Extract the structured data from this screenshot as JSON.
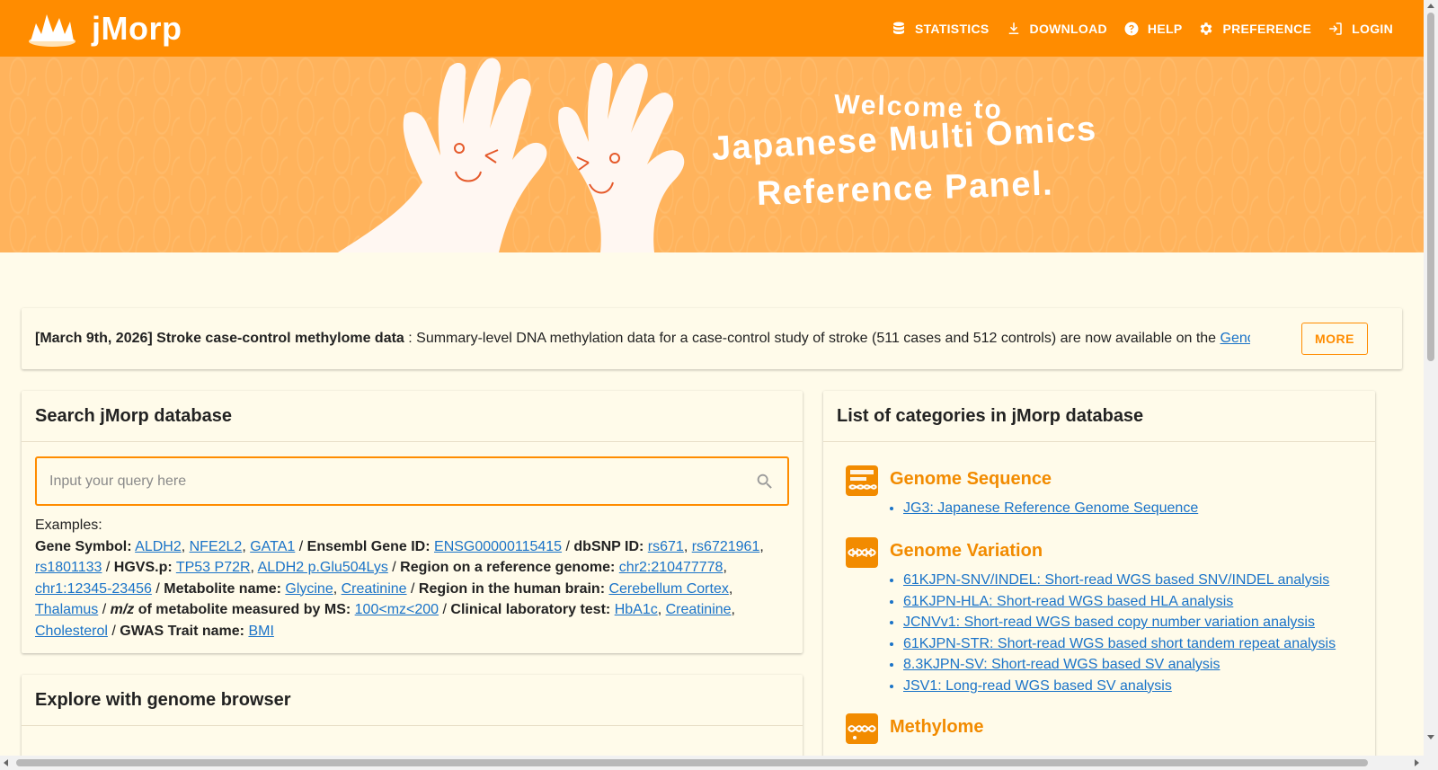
{
  "header": {
    "title": "jMorp",
    "nav": [
      {
        "label": "STATISTICS",
        "icon": "database-icon"
      },
      {
        "label": "DOWNLOAD",
        "icon": "download-icon"
      },
      {
        "label": "HELP",
        "icon": "help-icon"
      },
      {
        "label": "PREFERENCE",
        "icon": "gear-icon"
      },
      {
        "label": "LOGIN",
        "icon": "login-icon"
      }
    ]
  },
  "hero": {
    "line1": "Welcome to",
    "line2": "Japanese Multi Omics",
    "line3": "Reference Panel."
  },
  "news": {
    "date": "[March 9th, 2026]",
    "headline": "Stroke case-control methylome data",
    "body": " : Summary-level DNA methylation data for a case-control study of stroke (511 cases and 512 controls) are now available on the ",
    "link": "Genome",
    "more_label": "MORE"
  },
  "search": {
    "title": "Search jMorp database",
    "placeholder": "Input your query here",
    "examples_label": "Examples:",
    "groups": {
      "gene_symbol": {
        "label": "Gene Symbol:",
        "items": [
          "ALDH2",
          "NFE2L2",
          "GATA1"
        ]
      },
      "ensembl": {
        "label": "Ensembl Gene ID:",
        "items": [
          "ENSG00000115415"
        ]
      },
      "dbsnp": {
        "label": "dbSNP ID:",
        "items": [
          "rs671",
          "rs6721961",
          "rs1801133"
        ]
      },
      "hgvs": {
        "label": "HGVS.p:",
        "items": [
          "TP53 P72R",
          "ALDH2 p.Glu504Lys"
        ]
      },
      "region": {
        "label": "Region on a reference genome:",
        "items": [
          "chr2:210477778",
          "chr1:12345-23456"
        ]
      },
      "metabolite": {
        "label": "Metabolite name:",
        "items": [
          "Glycine",
          "Creatinine"
        ]
      },
      "brain": {
        "label": "Region in the human brain:",
        "items": [
          "Cerebellum Cortex",
          "Thalamus"
        ]
      },
      "mz": {
        "label_italic": "m/z",
        "label_rest": " of metabolite measured by MS:",
        "items": [
          "100<mz<200"
        ]
      },
      "clinical": {
        "label": "Clinical laboratory test:",
        "items": [
          "HbA1c",
          "Creatinine",
          "Cholesterol"
        ]
      },
      "gwas": {
        "label": "GWAS Trait name:",
        "items": [
          "BMI"
        ]
      }
    }
  },
  "explore": {
    "title": "Explore with genome browser"
  },
  "categories": {
    "title": "List of categories in jMorp database",
    "groups": [
      {
        "name": "Genome Sequence",
        "icon": "genome-sequence-icon",
        "items": [
          "JG3: Japanese Reference Genome Sequence"
        ]
      },
      {
        "name": "Genome Variation",
        "icon": "dna-icon",
        "items": [
          "61KJPN-SNV/INDEL: Short-read WGS based SNV/INDEL analysis",
          "61KJPN-HLA: Short-read WGS based HLA analysis",
          "JCNVv1: Short-read WGS based copy number variation analysis",
          "61KJPN-STR: Short-read WGS based short tandem repeat analysis",
          "8.3KJPN-SV: Short-read WGS based SV analysis",
          "JSV1: Long-read WGS based SV analysis"
        ]
      },
      {
        "name": "Methylome",
        "icon": "methylome-icon",
        "items": []
      }
    ]
  },
  "colors": {
    "brand": "#ff8c00",
    "link": "#1a73c8",
    "background": "#fffbea",
    "hero": "#ffb35c"
  }
}
